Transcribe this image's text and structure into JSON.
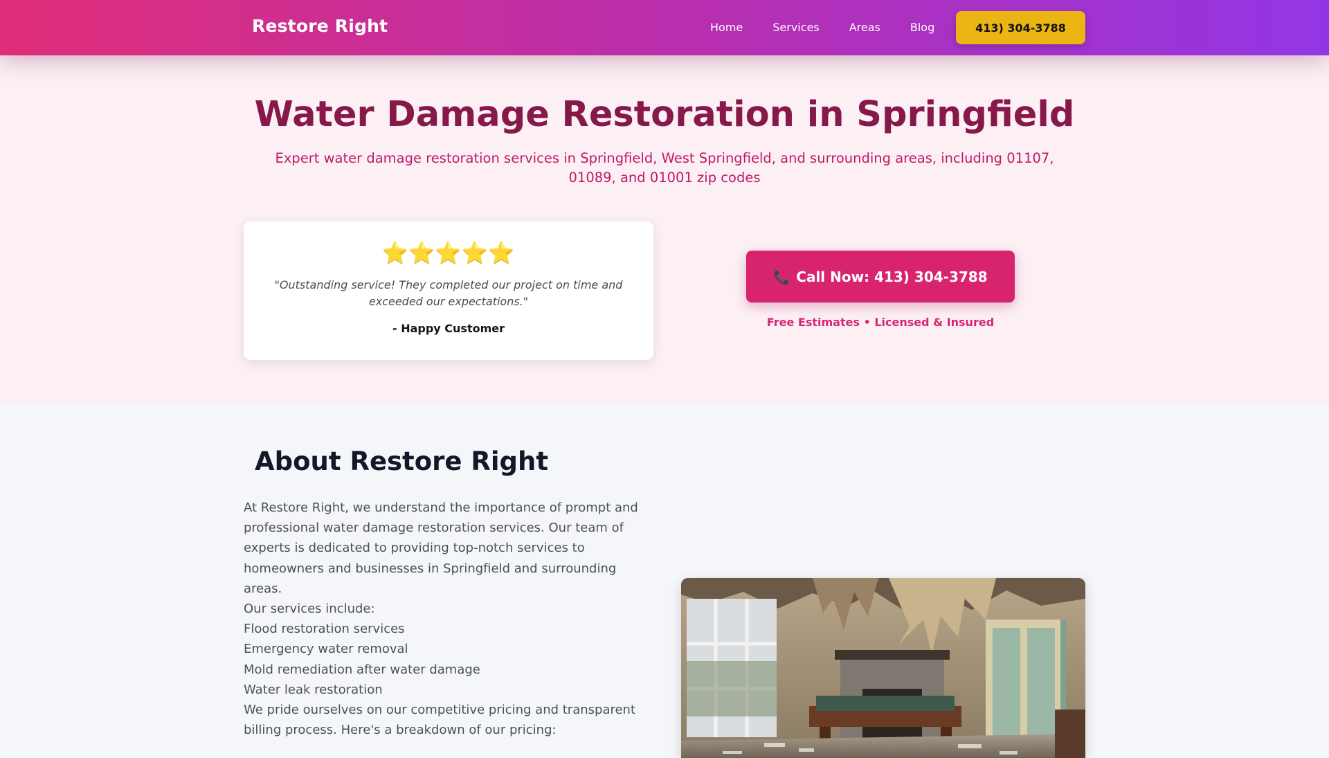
{
  "nav": {
    "brand": "Restore Right",
    "links": [
      "Home",
      "Services",
      "Areas",
      "Blog"
    ],
    "cta": "413) 304-3788"
  },
  "hero": {
    "title": "Water Damage Restoration in Springfield",
    "subtitle": "Expert water damage restoration services in Springfield, West Springfield, and surrounding areas, including 01107, 01089, and 01001 zip codes",
    "testimonial": {
      "stars": "⭐⭐⭐⭐⭐",
      "rating": 5,
      "quote": "\"Outstanding service! They completed our project on time and exceeded our expectations.\"",
      "author": "- Happy Customer"
    },
    "call_button": "Call Now: 413) 304-3788",
    "phone_icon": "phone-icon",
    "assurance": "Free Estimates • Licensed & Insured"
  },
  "about": {
    "title": "About Restore Right",
    "intro": "At Restore Right, we understand the importance of prompt and professional water damage restoration services. Our team of experts is dedicated to providing top-notch services to homeowners and businesses in Springfield and surrounding areas.",
    "services_heading": "Our services include:",
    "services": [
      "Flood restoration services",
      "Emergency water removal",
      "Mold remediation after water damage",
      "Water leak restoration"
    ],
    "pricing_text": "We pride ourselves on our competitive pricing and transparent billing process. Here's a breakdown of our pricing:"
  },
  "colors": {
    "nav_gradient_start": "#df2d79",
    "nav_gradient_end": "#9236e5",
    "accent_pink": "#d8246f",
    "title_maroon": "#86184a",
    "cta_gold": "#ebb514",
    "hero_bg": "#fcf0f5"
  }
}
